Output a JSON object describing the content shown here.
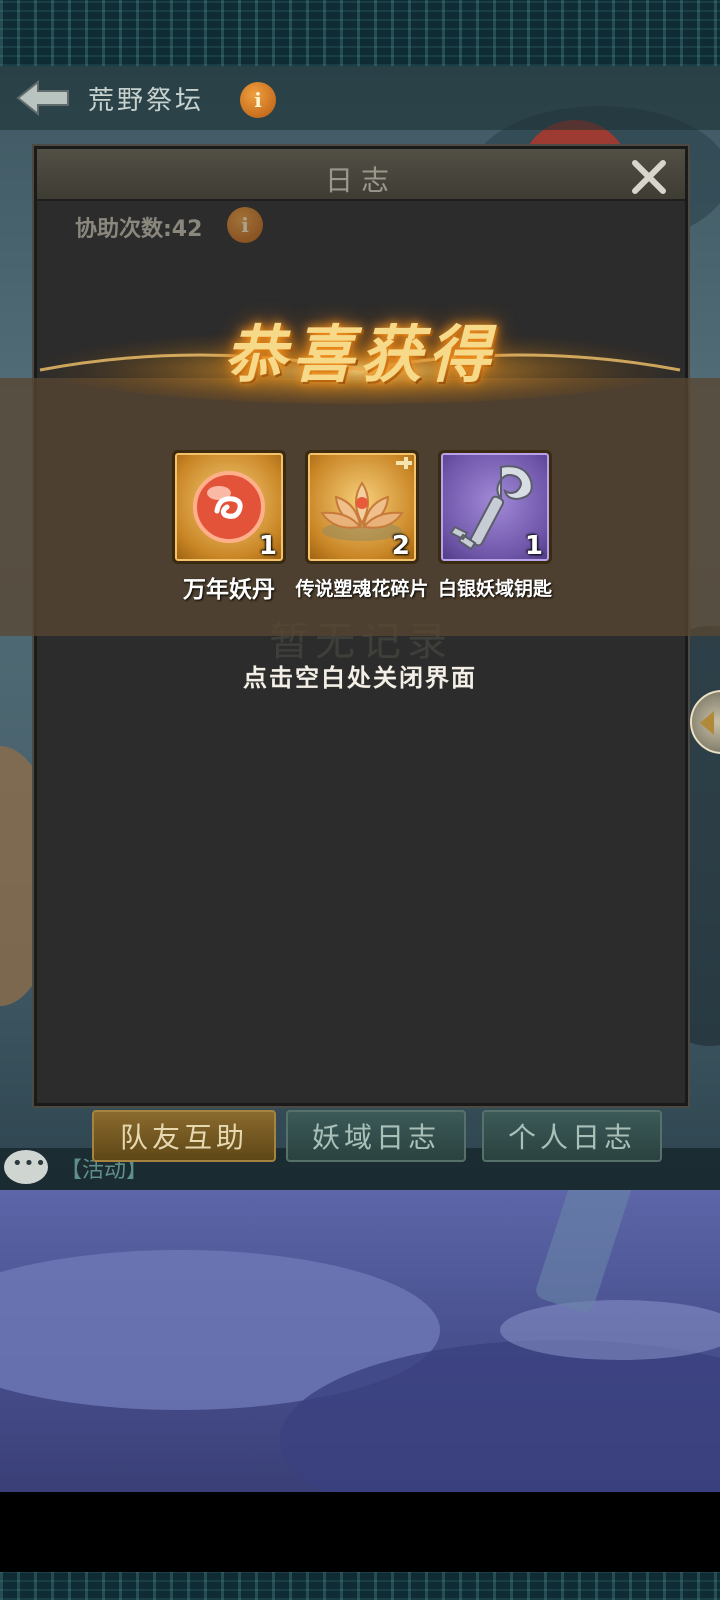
{
  "header": {
    "title": "荒野祭坛",
    "info_glyph": "i"
  },
  "dialog": {
    "title": "日志",
    "assist_count_label": "协助次数:42",
    "empty_text": "暂无记录"
  },
  "tabs": [
    {
      "label": "队友互助",
      "active": true
    },
    {
      "label": "妖域日志",
      "active": false
    },
    {
      "label": "个人日志",
      "active": false
    }
  ],
  "chat": {
    "text": "【活动】"
  },
  "reward": {
    "title": "恭喜获得",
    "items": [
      {
        "name": "万年妖丹",
        "qty": "1",
        "icon": "orb-icon",
        "rarity_color": "#d9952e"
      },
      {
        "name": "传说塑魂花碎片",
        "qty": "2",
        "icon": "lotus-fragment-icon",
        "rarity_color": "#d9952e"
      },
      {
        "name": "白银妖域钥匙",
        "qty": "1",
        "icon": "silver-key-icon",
        "rarity_color": "#7b62b6"
      }
    ],
    "close_hint": "点击空白处关闭界面"
  }
}
